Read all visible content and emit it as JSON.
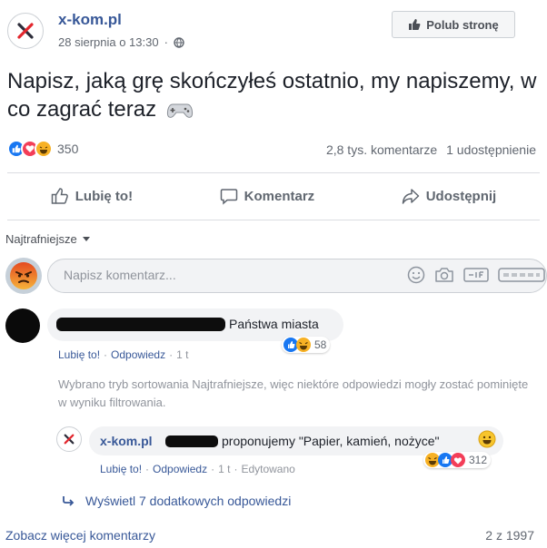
{
  "post": {
    "page_name": "x-kom.pl",
    "date": "28 sierpnia o 13:30",
    "meta_separator": "·",
    "like_page_label": "Polub stronę",
    "text": "Napisz, jaką grę skończyłeś ostatnio, my napiszemy, w co zagrać teraz",
    "reaction_count": "350",
    "comments_count": "2,8 tys. komentarze",
    "shares_count": "1 udostępnienie"
  },
  "actions": {
    "like": "Lubię to!",
    "comment": "Komentarz",
    "share": "Udostępnij"
  },
  "sort": {
    "label": "Najtrafniejsze"
  },
  "composer": {
    "placeholder": "Napisz komentarz..."
  },
  "comments": [
    {
      "text": "Państwa miasta",
      "reaction_count": "58",
      "like_label": "Lubię to!",
      "reply_label": "Odpowiedz",
      "time": "1 t",
      "separator": "·"
    }
  ],
  "filter_note": "Wybrano tryb sortowania Najtrafniejsze, więc niektóre odpowiedzi mogły zostać pominięte w wyniku filtrowania.",
  "reply": {
    "author": "x-kom.pl",
    "text": "proponujemy \"Papier, kamień, nożyce\"",
    "reaction_count": "312",
    "like_label": "Lubię to!",
    "reply_label": "Odpowiedz",
    "time": "1 t",
    "edited_label": "Edytowano",
    "separator": "·"
  },
  "more_replies": "Wyświetl 7 dodatkowych odpowiedzi",
  "footer": {
    "see_more": "Zobacz więcej komentarzy",
    "page_count": "2 z 1997"
  },
  "colors": {
    "link": "#385898",
    "like_blue": "#1877f2",
    "love_red": "#f33e58",
    "haha_yellow": "#f7b125",
    "angry": "#e9710f"
  }
}
